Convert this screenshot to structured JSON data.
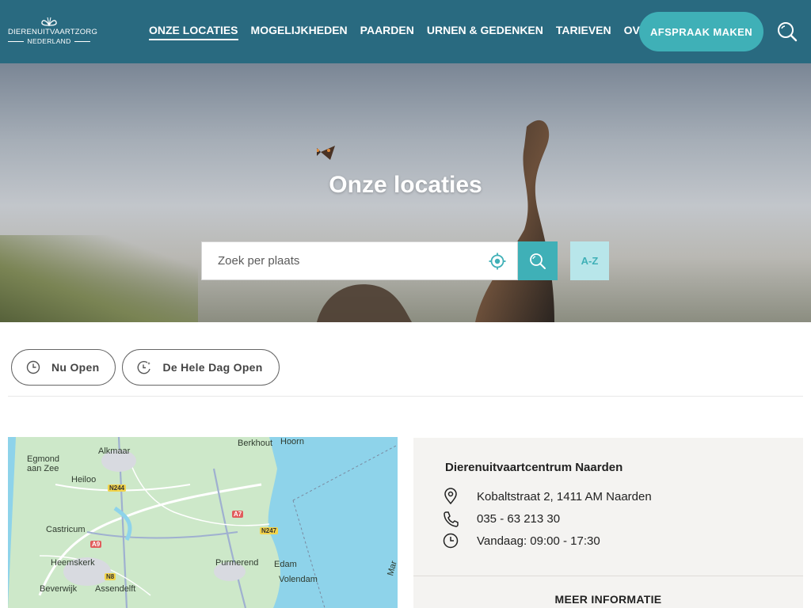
{
  "brand": {
    "line1": "DIERENUITVAARTZORG",
    "line2": "NEDERLAND"
  },
  "nav": {
    "items": [
      {
        "label": "ONZE LOCATIES",
        "active": true
      },
      {
        "label": "MOGELIJKHEDEN",
        "active": false
      },
      {
        "label": "PAARDEN",
        "active": false
      },
      {
        "label": "URNEN & GEDENKEN",
        "active": false
      },
      {
        "label": "TARIEVEN",
        "active": false
      },
      {
        "label": "OVER ONS",
        "active": false
      }
    ],
    "cta_label": "AFSPRAAK MAKEN"
  },
  "hero": {
    "title": "Onze locaties",
    "search_placeholder": "Zoek per plaats",
    "az_label": "A-Z"
  },
  "filters": {
    "now_open": "Nu Open",
    "all_day_open": "De Hele Dag Open"
  },
  "map": {
    "places": [
      "Egmond aan Zee",
      "Alkmaar",
      "Heiloo",
      "Berkhout",
      "Hoorn",
      "Castricum",
      "Heemskerk",
      "Beverwijk",
      "Assendelft",
      "Purmerend",
      "Edam",
      "Volendam",
      "Mar"
    ],
    "roads": [
      "N244",
      "A7",
      "N247",
      "A9",
      "N8"
    ]
  },
  "location": {
    "name": "Dierenuitvaartcentrum Naarden",
    "address": "Kobaltstraat 2, 1411 AM Naarden",
    "phone": "035 - 63 213 30",
    "hours": "Vandaag: 09:00 - 17:30",
    "more_label": "MEER INFORMATIE"
  },
  "colors": {
    "header": "#296a80",
    "accent": "#3fb0b7",
    "accent_light": "#b8e6ea",
    "card_bg": "#f4f3f1"
  }
}
